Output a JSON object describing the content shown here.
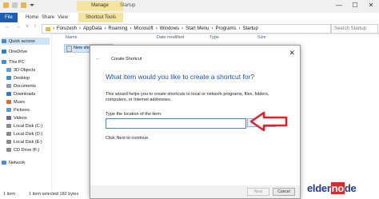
{
  "window": {
    "manage_label": "Manage",
    "title_path": "Startup",
    "minimize": "—",
    "maximize": "☐",
    "close": "✕"
  },
  "ribbon": {
    "file_tab": "File",
    "tabs": [
      "Home",
      "Share",
      "View"
    ],
    "shortcut_tools": "Shortcut Tools"
  },
  "address": {
    "segments": [
      "Foruzesh",
      "AppData",
      "Roaming",
      "Microsoft",
      "Windows",
      "Start Menu",
      "Programs",
      "Startup"
    ],
    "search_placeholder": "Search Startup"
  },
  "sidebar": {
    "items": [
      {
        "label": "Quick access",
        "icon": "star-icon",
        "color": "#3c8ee0"
      },
      {
        "label": "OneDrive",
        "icon": "cloud-icon",
        "color": "#2f7bd4"
      },
      {
        "label": "This PC",
        "icon": "computer-icon",
        "color": "#3a8fd8"
      },
      {
        "label": "3D Objects",
        "icon": "cube-icon",
        "color": "#52a3e8"
      },
      {
        "label": "Desktop",
        "icon": "desktop-icon",
        "color": "#3a8fd8"
      },
      {
        "label": "Documents",
        "icon": "document-icon",
        "color": "#8a9bb0"
      },
      {
        "label": "Downloads",
        "icon": "download-icon",
        "color": "#2f7bd4"
      },
      {
        "label": "Music",
        "icon": "music-icon",
        "color": "#e26a2c"
      },
      {
        "label": "Pictures",
        "icon": "pictures-icon",
        "color": "#4aa0e6"
      },
      {
        "label": "Videos",
        "icon": "video-icon",
        "color": "#7b5ea7"
      },
      {
        "label": "Local Disk (C:)",
        "icon": "drive-icon",
        "color": "#8a8a8a"
      },
      {
        "label": "Local Disk (D:)",
        "icon": "drive-icon",
        "color": "#8a8a8a"
      },
      {
        "label": "Local Disk (E:)",
        "icon": "drive-icon",
        "color": "#8a8a8a"
      },
      {
        "label": "CD Drive (F:)",
        "icon": "cd-icon",
        "color": "#8a8a8a"
      },
      {
        "label": "Network",
        "icon": "network-icon",
        "color": "#3a8fd8"
      }
    ]
  },
  "filelist": {
    "columns": [
      "Name",
      "Date modified",
      "Type",
      "Size"
    ],
    "rows": [
      {
        "name": "New shortcut"
      }
    ]
  },
  "status": {
    "items_count": "1 item",
    "selection": "1 item selected  182 bytes"
  },
  "dialog": {
    "title": "Create Shortcut",
    "heading": "What item would you like to create a shortcut for?",
    "description": "This wizard helps you to create shortcuts to local or network programs, files, folders, computers, or Internet addresses.",
    "location_label": "Type the location of the item:",
    "location_value": "",
    "browse_label": "Browse...",
    "next_message": "Click Next to continue.",
    "next_button": "Next",
    "cancel_button": "Cancel",
    "accent_color": "#1e50b3"
  },
  "annotation": {
    "arrow_color": "#e2202a"
  },
  "watermark": {
    "text_main": "elder",
    "text_hi": "no",
    "text_end": "de"
  }
}
